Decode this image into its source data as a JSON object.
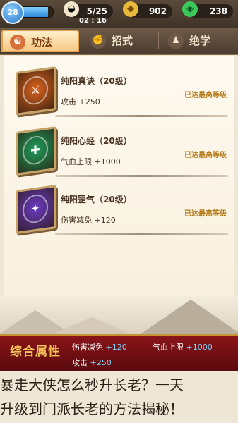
{
  "topbar": {
    "level": "28",
    "level_fill": 0.85,
    "resources": [
      {
        "icon": "rice-bun-icon",
        "value": "5/25",
        "timer": "02 : 16"
      },
      {
        "icon": "gold-ingot-icon",
        "value": "902"
      },
      {
        "icon": "jade-icon",
        "value": "238"
      }
    ]
  },
  "tabs": [
    {
      "label": "功法",
      "icon": "scroll-icon",
      "active": true
    },
    {
      "label": "招式",
      "icon": "fist-icon",
      "active": false
    },
    {
      "label": "绝学",
      "icon": "master-icon",
      "active": false
    }
  ],
  "skills": [
    {
      "name": "纯阳真诀（20级）",
      "stat": "攻击 +250",
      "status": "已达最高等级",
      "color": "#d9621c",
      "glyph": "⚔"
    },
    {
      "name": "纯阳心经（20级）",
      "stat": "气血上限 +1000",
      "status": "已达最高等级",
      "color": "#1e9d5a",
      "glyph": "✚"
    },
    {
      "name": "纯阳罡气（20级）",
      "stat": "伤害减免 +120",
      "status": "已达最高等级",
      "color": "#6a3ac2",
      "glyph": "✦"
    }
  ],
  "summary": {
    "title": "综合属性",
    "stats": [
      {
        "label": "伤害减免",
        "value": "+120"
      },
      {
        "label": "气血上限",
        "value": "+1000"
      },
      {
        "label": "攻击",
        "value": "+250"
      }
    ]
  },
  "caption": {
    "line1": "暴走大侠怎么秒升长老？一天",
    "line2": "升级到门派长老的方法揭秘！"
  }
}
